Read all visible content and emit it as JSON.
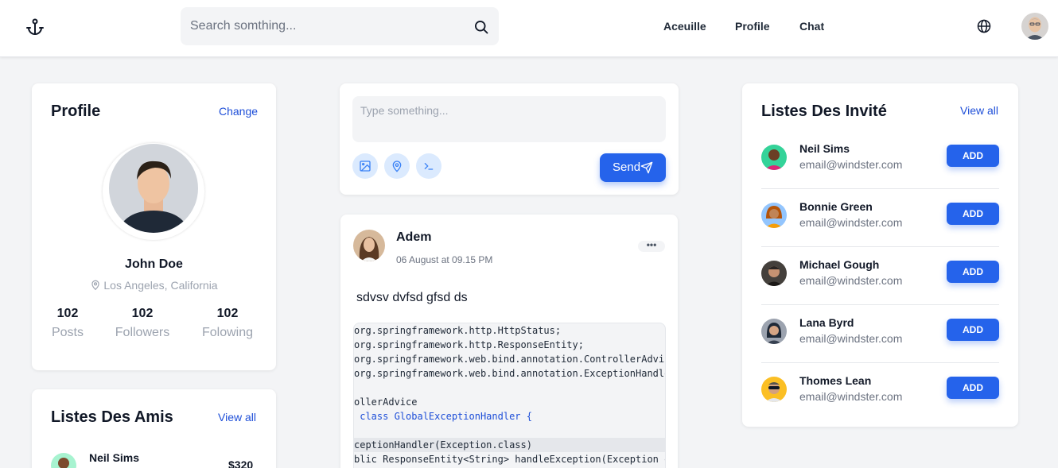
{
  "navbar": {
    "logo_icon": "anchor-icon",
    "search_placeholder": "Search somthing...",
    "links": [
      "Aceuille",
      "Profile",
      "Chat"
    ],
    "language_icon": "globe-icon",
    "user_avatar": "user-avatar"
  },
  "profile": {
    "title": "Profile",
    "change_label": "Change",
    "name": "John Doe",
    "location": "Los Angeles, California",
    "stats": [
      {
        "value": "102",
        "label": "Posts"
      },
      {
        "value": "102",
        "label": "Followers"
      },
      {
        "value": "102",
        "label": "Folowing"
      }
    ]
  },
  "friends": {
    "title": "Listes Des Amis",
    "view_all": "View all",
    "items": [
      {
        "name": "Neil Sims",
        "amount": "$320"
      }
    ]
  },
  "composer": {
    "placeholder": "Type something...",
    "send_label": "Send",
    "tools": [
      "image-icon",
      "location-pin-icon",
      "terminal-icon"
    ]
  },
  "post": {
    "author": "Adem",
    "time": "06 August at 09.15 PM",
    "more_label": "•••",
    "text": "sdvsv dvfsd gfsd ds",
    "code_lines": [
      "org.springframework.http.HttpStatus;",
      "org.springframework.http.ResponseEntity;",
      "org.springframework.web.bind.annotation.ControllerAdvice;",
      "org.springframework.web.bind.annotation.ExceptionHandler;",
      "",
      "ollerAdvice",
      " class GlobalExceptionHandler {",
      "",
      "ceptionHandler(Exception.class)",
      "blic ResponseEntity<String> handleException(Exception e) {"
    ]
  },
  "invites": {
    "title": "Listes Des Invité",
    "view_all": "View all",
    "add_label": "ADD",
    "items": [
      {
        "name": "Neil Sims",
        "email": "email@windster.com"
      },
      {
        "name": "Bonnie Green",
        "email": "email@windster.com"
      },
      {
        "name": "Michael Gough",
        "email": "email@windster.com"
      },
      {
        "name": "Lana Byrd",
        "email": "email@windster.com"
      },
      {
        "name": "Thomes Lean",
        "email": "email@windster.com"
      }
    ]
  },
  "colors": {
    "accent": "#2563eb",
    "background": "#f3f4f6",
    "card": "#ffffff"
  }
}
